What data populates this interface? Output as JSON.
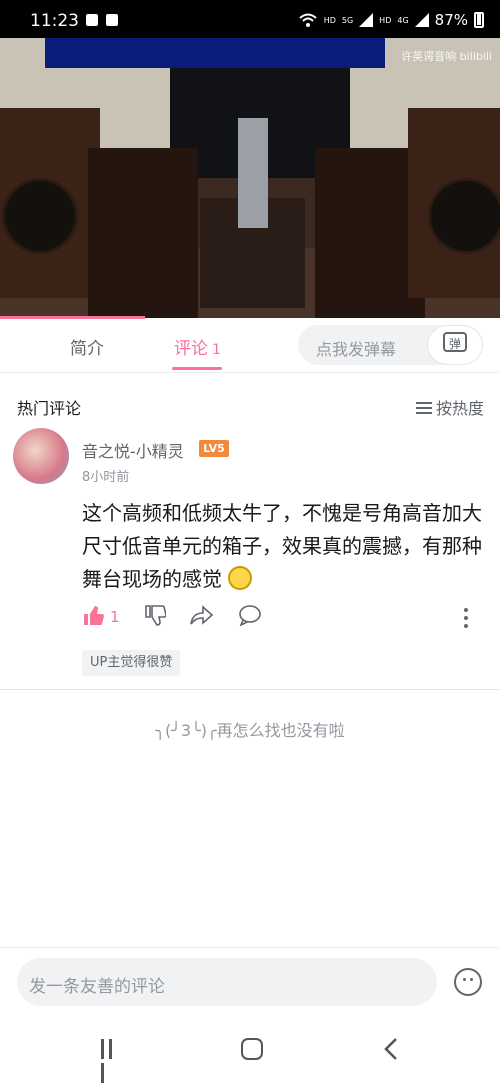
{
  "status_bar": {
    "time": "11:23",
    "network": "HD",
    "signal_5g": "5G",
    "network2": "HD",
    "signal_4g": "4G",
    "battery": "87%"
  },
  "video": {
    "watermark": "许英谔音响 bilibili"
  },
  "tabs": {
    "intro": "简介",
    "comments": "评论",
    "comments_count": "1",
    "danmu_placeholder": "点我发弹幕",
    "danmu_button": "弹"
  },
  "comments_header": {
    "title": "热门评论",
    "sort_label": "按热度"
  },
  "comment": {
    "username": "音之悦-小精灵",
    "level": "LV5",
    "time": "8小时前",
    "text": "这个高频和低频太牛了，不愧是号角高音加大尺寸低音单元的箱子，效果真的震撼，有那种舞台现场的感觉",
    "likes": "1",
    "up_badge": "UP主觉得很赞"
  },
  "end_text": "╮(╯3╰)╭再怎么找也没有啦",
  "input_bar": {
    "placeholder": "发一条友善的评论"
  }
}
